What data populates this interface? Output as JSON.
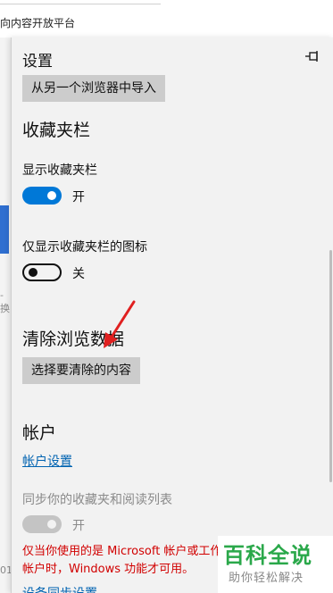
{
  "background": {
    "bookmark_text": "向内容开放平台",
    "left_fragment_1": "-换",
    "left_fragment_2": "01"
  },
  "panel": {
    "title": "设置",
    "pin_icon": "pin-icon",
    "import_button": "从另一个浏览器中导入",
    "favorites_section": {
      "heading": "收藏夹栏",
      "show_bar_label": "显示收藏夹栏",
      "show_bar_state": "开",
      "icons_only_label": "仅显示收藏夹栏的图标",
      "icons_only_state": "关"
    },
    "clear_section": {
      "heading": "清除浏览数据",
      "choose_button": "选择要清除的内容"
    },
    "account_section": {
      "heading": "帐户",
      "account_settings_link": "帐户设置",
      "sync_label": "同步你的收藏夹和阅读列表",
      "sync_state": "开",
      "warning": "仅当你使用的是 Microsoft 帐户或工作帐户时，Windows 功能才可用。",
      "sync_settings_link": "设备同步设置"
    }
  },
  "annotation": {
    "arrow_color": "#e02020"
  },
  "watermark": {
    "main": "百科全说",
    "sub": "助你轻松解决"
  },
  "colors": {
    "accent": "#0078d7",
    "warning": "#d10000",
    "link": "#0063b1"
  }
}
